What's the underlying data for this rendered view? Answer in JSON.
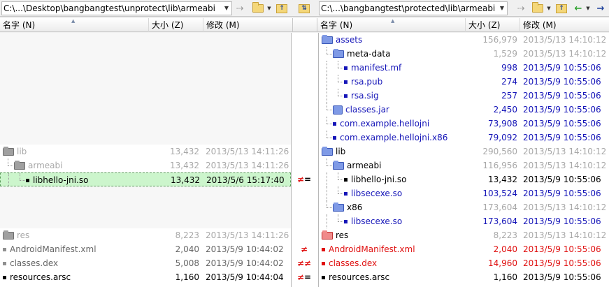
{
  "left": {
    "path": "C:\\...\\Desktop\\bangbangtest\\unprotect\\lib\\armeabi",
    "columns": {
      "name": "名字 (N)",
      "size": "大小 (Z)",
      "modified": "修改 (M)"
    },
    "rows": [
      {
        "type": "blank"
      },
      {
        "type": "blank"
      },
      {
        "type": "blank"
      },
      {
        "type": "blank"
      },
      {
        "type": "blank"
      },
      {
        "type": "blank"
      },
      {
        "type": "blank"
      },
      {
        "type": "blank"
      },
      {
        "type": "item",
        "icon": "folder-gray",
        "level": 0,
        "name": "lib",
        "size": "13,432",
        "modified": "2013/5/13 14:11:26",
        "color": "gray"
      },
      {
        "type": "item",
        "icon": "folder-gray",
        "level": 1,
        "name": "armeabi",
        "size": "13,432",
        "modified": "2013/5/13 14:11:26",
        "color": "gray"
      },
      {
        "type": "item",
        "icon": "file-black",
        "level": 2,
        "name": "libhello-jni.so",
        "size": "13,432",
        "modified": "2013/5/6 15:17:40",
        "color": "black",
        "selected": true
      },
      {
        "type": "blank"
      },
      {
        "type": "blank"
      },
      {
        "type": "blank"
      },
      {
        "type": "item",
        "icon": "folder-gray",
        "level": 0,
        "name": "res",
        "size": "8,223",
        "modified": "2013/5/13 14:11:26",
        "color": "gray"
      },
      {
        "type": "item",
        "icon": "file-gray",
        "level": 0,
        "name": "AndroidManifest.xml",
        "size": "2,040",
        "modified": "2013/5/9 10:44:02",
        "color": "darkgray"
      },
      {
        "type": "item",
        "icon": "file-gray",
        "level": 0,
        "name": "classes.dex",
        "size": "5,008",
        "modified": "2013/5/9 10:44:02",
        "color": "darkgray"
      },
      {
        "type": "item",
        "icon": "file-black",
        "level": 0,
        "name": "resources.arsc",
        "size": "1,160",
        "modified": "2013/5/9 10:44:04",
        "color": "black"
      }
    ]
  },
  "right": {
    "path": "C:\\...\\bangbangtest\\protected\\lib\\armeabi",
    "columns": {
      "name": "名字 (N)",
      "size": "大小 (Z)",
      "modified": "修改 (M)"
    },
    "rows": [
      {
        "type": "item",
        "icon": "folder-blue",
        "level": 0,
        "name": "assets",
        "size": "156,979",
        "modified": "2013/5/13 14:10:12",
        "color": "blue",
        "meta": "gray"
      },
      {
        "type": "item",
        "icon": "folder-blue",
        "level": 1,
        "name": "meta-data",
        "size": "1,529",
        "modified": "2013/5/13 14:10:12",
        "color": "black",
        "meta": "gray"
      },
      {
        "type": "item",
        "icon": "file-blue",
        "level": 2,
        "name": "manifest.mf",
        "size": "998",
        "modified": "2013/5/9 10:55:06",
        "color": "blue"
      },
      {
        "type": "item",
        "icon": "file-blue",
        "level": 2,
        "name": "rsa.pub",
        "size": "274",
        "modified": "2013/5/9 10:55:06",
        "color": "blue"
      },
      {
        "type": "item",
        "icon": "file-blue",
        "level": 2,
        "name": "rsa.sig",
        "size": "257",
        "modified": "2013/5/9 10:55:06",
        "color": "blue"
      },
      {
        "type": "item",
        "icon": "jar-blue",
        "level": 1,
        "name": "classes.jar",
        "size": "2,450",
        "modified": "2013/5/9 10:55:06",
        "color": "blue"
      },
      {
        "type": "item",
        "icon": "file-blue",
        "level": 1,
        "name": "com.example.hellojni",
        "size": "73,908",
        "modified": "2013/5/9 10:55:06",
        "color": "blue"
      },
      {
        "type": "item",
        "icon": "file-blue",
        "level": 1,
        "name": "com.example.hellojni.x86",
        "size": "79,092",
        "modified": "2013/5/9 10:55:06",
        "color": "blue"
      },
      {
        "type": "item",
        "icon": "folder-blue",
        "level": 0,
        "name": "lib",
        "size": "290,560",
        "modified": "2013/5/13 14:10:12",
        "color": "black",
        "meta": "gray"
      },
      {
        "type": "item",
        "icon": "folder-blue",
        "level": 1,
        "name": "armeabi",
        "size": "116,956",
        "modified": "2013/5/13 14:10:12",
        "color": "black",
        "meta": "gray"
      },
      {
        "type": "item",
        "icon": "file-black",
        "level": 2,
        "name": "libhello-jni.so",
        "size": "13,432",
        "modified": "2013/5/9 10:55:06",
        "color": "black"
      },
      {
        "type": "item",
        "icon": "file-blue",
        "level": 2,
        "name": "libsecexe.so",
        "size": "103,524",
        "modified": "2013/5/9 10:55:06",
        "color": "blue"
      },
      {
        "type": "item",
        "icon": "folder-blue",
        "level": 1,
        "name": "x86",
        "size": "173,604",
        "modified": "2013/5/13 14:10:12",
        "color": "black",
        "meta": "gray"
      },
      {
        "type": "item",
        "icon": "file-blue",
        "level": 2,
        "name": "libsecexe.so",
        "size": "173,604",
        "modified": "2013/5/9 10:55:06",
        "color": "blue"
      },
      {
        "type": "item",
        "icon": "folder-red",
        "level": 0,
        "name": "res",
        "size": "8,223",
        "modified": "2013/5/13 14:10:12",
        "color": "black",
        "meta": "gray"
      },
      {
        "type": "item",
        "icon": "file-red",
        "level": 0,
        "name": "AndroidManifest.xml",
        "size": "2,040",
        "modified": "2013/5/9 10:55:06",
        "color": "red"
      },
      {
        "type": "item",
        "icon": "file-red",
        "level": 0,
        "name": "classes.dex",
        "size": "14,960",
        "modified": "2013/5/9 10:55:06",
        "color": "red"
      },
      {
        "type": "item",
        "icon": "file-black",
        "level": 0,
        "name": "resources.arsc",
        "size": "1,160",
        "modified": "2013/5/9 10:55:06",
        "color": "black"
      }
    ]
  },
  "compare": [
    {
      "row": 10,
      "symbol": "≠=",
      "kind": "mixed"
    },
    {
      "row": 15,
      "symbol": "≠",
      "kind": "neq"
    },
    {
      "row": 16,
      "symbol": "≠≠",
      "kind": "neq"
    },
    {
      "row": 17,
      "symbol": "≠=",
      "kind": "mixed"
    }
  ],
  "colors": {
    "selected_bg": "#ccf5cc",
    "diff_red": "#e01010",
    "only_blue": "#1515b8",
    "older_gray": "#a8a8a8"
  }
}
